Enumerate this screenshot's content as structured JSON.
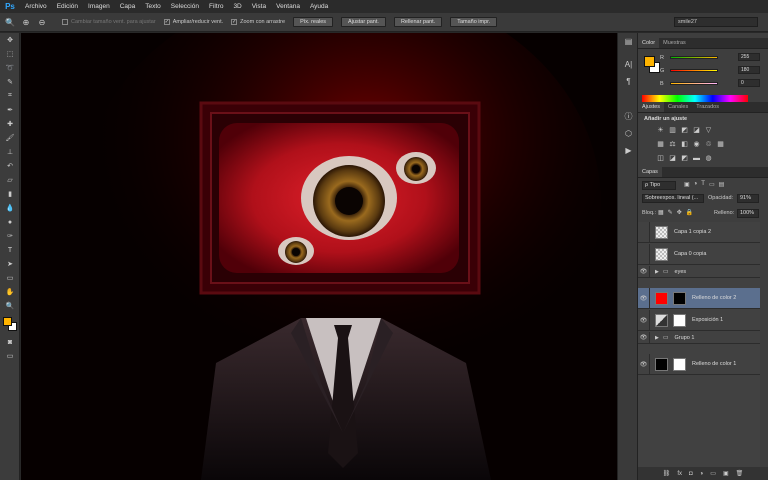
{
  "app": {
    "logo": "Ps"
  },
  "menu": [
    "Archivo",
    "Edición",
    "Imagen",
    "Capa",
    "Texto",
    "Selección",
    "Filtro",
    "3D",
    "Vista",
    "Ventana",
    "Ayuda"
  ],
  "options": {
    "checks": [
      {
        "label": "Cambiar tamaño vent. para ajustar",
        "checked": false,
        "dim": true
      },
      {
        "label": "Ampliar/reducir vent.",
        "checked": true,
        "dim": false
      },
      {
        "label": "Zoom con arrastre",
        "checked": true,
        "dim": false
      }
    ],
    "buttons": [
      "Píx. reales",
      "Ajustar pant.",
      "Rellenar pant.",
      "Tamaño impr."
    ],
    "workspace": "smile27"
  },
  "color_panel": {
    "tabs": [
      "Color",
      "Muestras"
    ],
    "sliders": [
      {
        "label": "R",
        "value": "255"
      },
      {
        "label": "G",
        "value": "180"
      },
      {
        "label": "B",
        "value": "0"
      }
    ],
    "foreground": "#ffb400"
  },
  "adjust_panel": {
    "tabs": [
      "Ajustes",
      "Canales",
      "Trazados"
    ],
    "title": "Añadir un ajuste"
  },
  "layers_panel": {
    "tab": "Capas",
    "filter": "Tipo",
    "blend_mode": "Sobreexpos. lineal (...",
    "opacity_label": "Opacidad:",
    "opacity": "91%",
    "lock_label": "Bloq.:",
    "fill_label": "Relleno:",
    "fill": "100%",
    "layers": [
      {
        "name": "Capa 1 copia 2",
        "visible": false,
        "kind": "checker",
        "selected": false,
        "indent": 0
      },
      {
        "name": "Capa 0 copia",
        "visible": false,
        "kind": "checker",
        "selected": false,
        "indent": 0
      },
      {
        "name": "eyes",
        "visible": true,
        "kind": "group",
        "selected": false,
        "indent": 0
      },
      {
        "name": "Relleno de color 2",
        "visible": true,
        "kind": "fill-red",
        "selected": true,
        "indent": 0
      },
      {
        "name": "Exposición 1",
        "visible": true,
        "kind": "adjust",
        "selected": false,
        "indent": 0
      },
      {
        "name": "Grupo 1",
        "visible": true,
        "kind": "group",
        "selected": false,
        "indent": 0
      },
      {
        "name": "Relleno de color 1",
        "visible": true,
        "kind": "fill-black",
        "selected": false,
        "indent": 0
      }
    ],
    "footer_icons": [
      "link-icon",
      "fx-icon",
      "mask-icon",
      "adjustment-icon",
      "folder-icon",
      "new-layer-icon",
      "trash-icon"
    ]
  }
}
